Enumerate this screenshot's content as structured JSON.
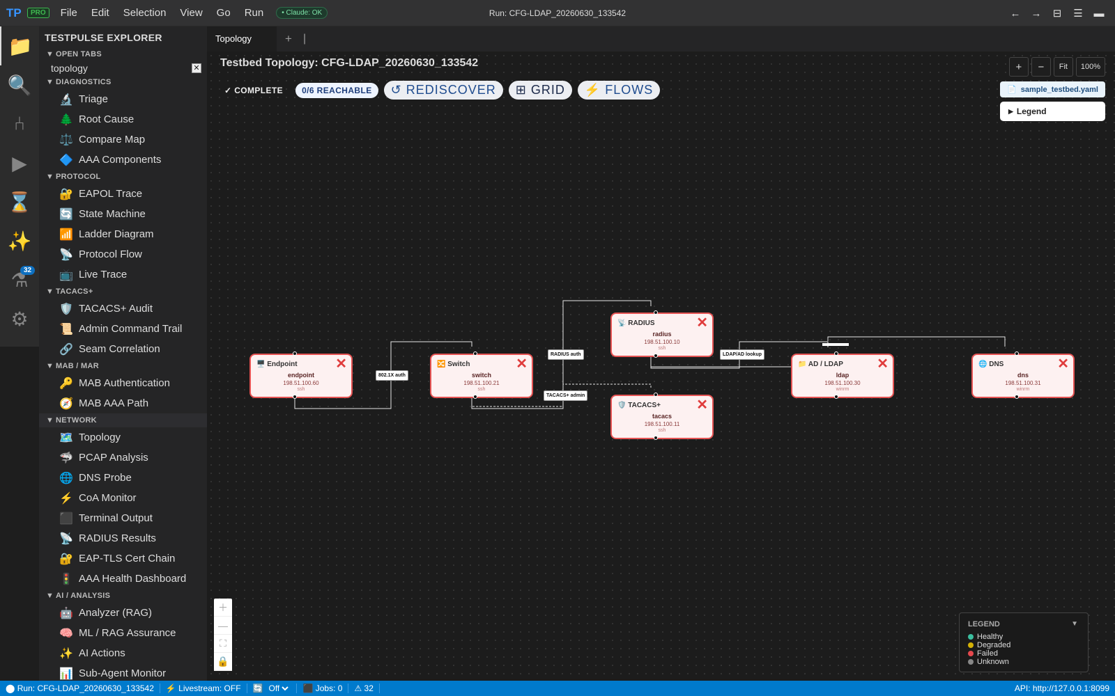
{
  "app": {
    "logo": "TP",
    "badge": "PRO",
    "menu": [
      "File",
      "Edit",
      "Selection",
      "View",
      "Go",
      "Run"
    ],
    "claude_status": "• Claude: OK",
    "run_title": "Run: CFG-LDAP_20260630_133542",
    "nav_back": "←",
    "nav_forward": "→",
    "layout_icon": "⊟",
    "menu_icon": "☰",
    "minimize_icon": "▬"
  },
  "activity": {
    "explorer": "📁",
    "search": "🔍",
    "source": "⑃",
    "run": "▶",
    "history": "⌛",
    "ai": "✨",
    "tests": "⚗",
    "tests_badge": "32",
    "settings": "⚙"
  },
  "sidebar": {
    "title": "TESTPULSE EXPLORER",
    "open_tabs_header": "OPEN TABS",
    "open_tab": "topology",
    "open_tab_close": "✕",
    "diagnostics": {
      "header": "DIAGNOSTICS",
      "items": [
        {
          "icon": "🔬",
          "label": "Triage"
        },
        {
          "icon": "🌲",
          "label": "Root Cause"
        },
        {
          "icon": "⚖️",
          "label": "Compare Map"
        },
        {
          "icon": "🔷",
          "label": "AAA Components"
        }
      ]
    },
    "protocol": {
      "header": "PROTOCOL",
      "items": [
        {
          "icon": "🔐",
          "label": "EAPOL Trace"
        },
        {
          "icon": "🔄",
          "label": "State Machine"
        },
        {
          "icon": "📶",
          "label": "Ladder Diagram"
        },
        {
          "icon": "📡",
          "label": "Protocol Flow"
        },
        {
          "icon": "📺",
          "label": "Live Trace"
        }
      ]
    },
    "tacacs": {
      "header": "TACACS+",
      "items": [
        {
          "icon": "🛡️",
          "label": "TACACS+ Audit"
        },
        {
          "icon": "📜",
          "label": "Admin Command Trail"
        },
        {
          "icon": "🔗",
          "label": "Seam Correlation"
        }
      ]
    },
    "mab": {
      "header": "MAB / MAR",
      "items": [
        {
          "icon": "🔑",
          "label": "MAB Authentication"
        },
        {
          "icon": "🧭",
          "label": "MAB AAA Path"
        }
      ]
    },
    "network": {
      "header": "NETWORK",
      "items": [
        {
          "icon": "🗺️",
          "label": "Topology"
        },
        {
          "icon": "🦈",
          "label": "PCAP Analysis"
        },
        {
          "icon": "🌐",
          "label": "DNS Probe"
        },
        {
          "icon": "⚡",
          "label": "CoA Monitor"
        },
        {
          "icon": "⬛",
          "label": "Terminal Output"
        },
        {
          "icon": "📡",
          "label": "RADIUS Results"
        },
        {
          "icon": "🔐",
          "label": "EAP-TLS Cert Chain"
        },
        {
          "icon": "🚦",
          "label": "AAA Health Dashboard"
        }
      ]
    },
    "ai": {
      "header": "AI / ANALYSIS",
      "items": [
        {
          "icon": "🤖",
          "label": "Analyzer (RAG)"
        },
        {
          "icon": "🧠",
          "label": "ML / RAG Assurance"
        },
        {
          "icon": "✨",
          "label": "AI Actions"
        },
        {
          "icon": "📊",
          "label": "Sub-Agent Monitor"
        }
      ]
    }
  },
  "tabs": {
    "active": "Topology",
    "add": "+",
    "sep": "|"
  },
  "topology": {
    "title": "Testbed Topology: CFG-LDAP_20260630_133542",
    "complete": "✓ COMPLETE",
    "reachable": "0/6 REACHABLE",
    "rediscover": "↺ REDISCOVER",
    "grid": "⊞ GRID",
    "flows": "⚡ FLOWS",
    "zoom_in": "+",
    "zoom_out": "−",
    "fit": "Fit",
    "zoom_level": "100%",
    "file_icon": "📄",
    "file": "sample_testbed.yaml",
    "legend_toggle_icon": "▶",
    "legend_button": "Legend",
    "nodes": [
      {
        "id": "endpoint",
        "icon": "🖥️",
        "type": "Endpoint",
        "name": "endpoint",
        "ip": "198.51.100.60",
        "proto": "ssh",
        "status": "failed",
        "status_icon": "✕"
      },
      {
        "id": "switch",
        "icon": "🔀",
        "type": "Switch",
        "name": "switch",
        "ip": "198.51.100.21",
        "proto": "ssh",
        "status": "failed",
        "status_icon": "✕"
      },
      {
        "id": "radius",
        "icon": "📡",
        "type": "RADIUS",
        "name": "radius",
        "ip": "198.51.100.10",
        "proto": "ssh",
        "status": "failed",
        "status_icon": "✕"
      },
      {
        "id": "tacacs",
        "icon": "🛡️",
        "type": "TACACS+",
        "name": "tacacs",
        "ip": "198.51.100.11",
        "proto": "ssh",
        "status": "failed",
        "status_icon": "✕"
      },
      {
        "id": "ldap",
        "icon": "📁",
        "type": "AD / LDAP",
        "name": "ldap",
        "ip": "198.51.100.30",
        "proto": "winrm",
        "status": "failed",
        "status_icon": "✕"
      },
      {
        "id": "dns",
        "icon": "🌐",
        "type": "DNS",
        "name": "dns",
        "ip": "198.51.100.31",
        "proto": "winrm",
        "status": "failed",
        "status_icon": "✕"
      }
    ],
    "edge_labels": {
      "dot1x": "802.1X auth",
      "radius": "RADIUS auth",
      "tacacs": "TACACS+ admin",
      "ldap": "LDAP/AD lookup"
    },
    "mini_zoom": {
      "in": "＋",
      "out": "—",
      "fit": "⛶",
      "lock": "🔒"
    },
    "legend": {
      "title": "LEGEND",
      "toggle": "▼",
      "items": [
        {
          "label": "Healthy",
          "color": "#3bbf9f"
        },
        {
          "label": "Degraded",
          "color": "#d4b106"
        },
        {
          "label": "Failed",
          "color": "#e5484d"
        },
        {
          "label": "Unknown",
          "color": "#888888"
        }
      ]
    }
  },
  "statusbar": {
    "run": "⬤ Run: CFG-LDAP_20260630_133542",
    "livestream": "⚡ Livestream: OFF",
    "refresh_icon": "🔄",
    "refresh_value": "Off",
    "jobs": "⬛ Jobs: 0",
    "warnings": "⚠ 32",
    "api": "API: http://127.0.0.1:8099"
  }
}
